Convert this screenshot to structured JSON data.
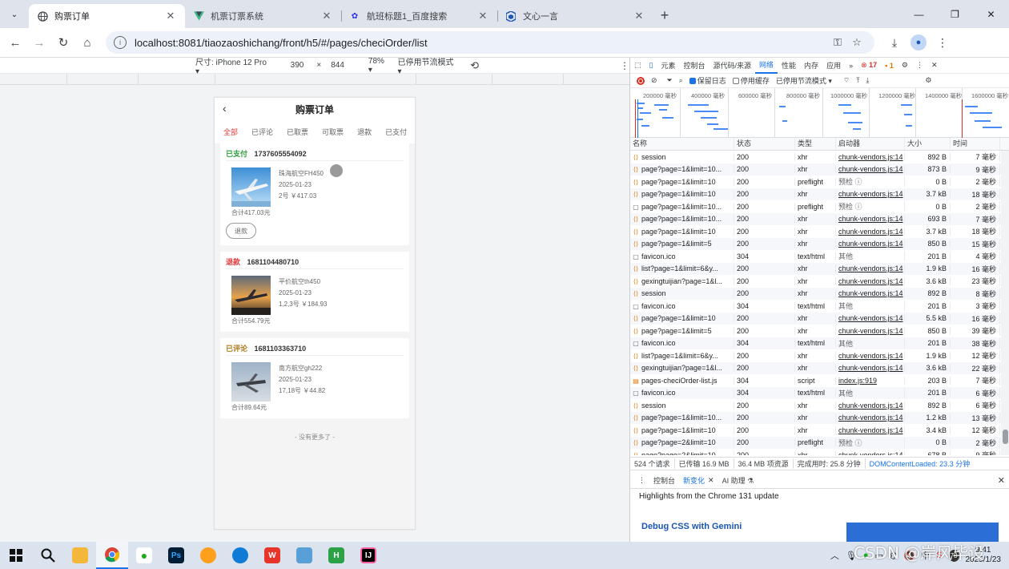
{
  "browser": {
    "tabs": [
      {
        "title": "购票订单",
        "icon": "globe-icon",
        "active": true
      },
      {
        "title": "机票订票系统",
        "icon": "vue-icon",
        "active": false
      },
      {
        "title": "航班标题1_百度搜索",
        "icon": "baidu-icon",
        "active": false
      },
      {
        "title": "文心一言",
        "icon": "cube-icon",
        "active": false
      }
    ],
    "url": "localhost:8081/tiaozaoshichang/front/h5/#/pages/checiOrder/list"
  },
  "device_toolbar": {
    "size_label": "尺寸: iPhone 12 Pro ▾",
    "width": "390",
    "times": "×",
    "height": "844",
    "zoom": "78% ▾",
    "throttle": "已停用节流模式 ▾"
  },
  "app": {
    "title": "购票订单",
    "back": "‹",
    "tabs": [
      "全部",
      "已评论",
      "已取票",
      "可取票",
      "退款",
      "已支付"
    ],
    "orders": [
      {
        "status": "已支付",
        "status_color": "#2e9e3a",
        "order_no": "1737605554092",
        "flight": "珠海航空FH450",
        "date": "2025-01-23",
        "seats": "2号 ￥417.03",
        "total": "合计417.03元",
        "action": "退款"
      },
      {
        "status": "退款",
        "status_color": "#e4393c",
        "order_no": "1681104480710",
        "flight": "平价航空th450",
        "date": "2025-01-23",
        "seats": "1,2,3号 ￥184.93",
        "total": "合计554.79元",
        "action": ""
      },
      {
        "status": "已评论",
        "status_color": "#b07a1a",
        "order_no": "1681103363710",
        "flight": "南方航空gh222",
        "date": "2025-01-23",
        "seats": "17,18号 ￥44.82",
        "total": "合计89.64元",
        "action": ""
      }
    ],
    "no_more": "- 没有更多了 -"
  },
  "devtools": {
    "tabs": [
      "元素",
      "控制台",
      "源代码/来源",
      "网络",
      "性能",
      "内存",
      "应用"
    ],
    "more": "»",
    "errors": "17",
    "warnings": "1",
    "filter": {
      "preserve_log": "保留日志",
      "disable_cache": "停用缓存",
      "throttle": "已停用节流模式"
    },
    "timeline_labels": [
      "200000 毫秒",
      "400000 毫秒",
      "600000 毫秒",
      "800000 毫秒",
      "1000000 毫秒",
      "1200000 毫秒",
      "1400000 毫秒",
      "1600000 毫秒"
    ],
    "columns": [
      "名称",
      "状态",
      "类型",
      "启动器",
      "大小",
      "时间"
    ],
    "rows": [
      {
        "name": "session",
        "status": "200",
        "type": "xhr",
        "initiator": "chunk-vendors.js:14",
        "size": "892 B",
        "time": "7 毫秒",
        "icon": "xhr"
      },
      {
        "name": "page?page=1&limit=10...",
        "status": "200",
        "type": "xhr",
        "initiator": "chunk-vendors.js:14",
        "size": "873 B",
        "time": "9 毫秒",
        "icon": "xhr"
      },
      {
        "name": "page?page=1&limit=10",
        "status": "200",
        "type": "preflight",
        "initiator": "预检 ⓘ",
        "size": "0 B",
        "time": "2 毫秒",
        "icon": "xhr"
      },
      {
        "name": "page?page=1&limit=10",
        "status": "200",
        "type": "xhr",
        "initiator": "chunk-vendors.js:14",
        "size": "3.7 kB",
        "time": "18 毫秒",
        "icon": "xhr"
      },
      {
        "name": "page?page=1&limit=10...",
        "status": "200",
        "type": "preflight",
        "initiator": "预检 ⓘ",
        "size": "0 B",
        "time": "2 毫秒",
        "icon": "doc"
      },
      {
        "name": "page?page=1&limit=10...",
        "status": "200",
        "type": "xhr",
        "initiator": "chunk-vendors.js:14",
        "size": "693 B",
        "time": "7 毫秒",
        "icon": "xhr"
      },
      {
        "name": "page?page=1&limit=10",
        "status": "200",
        "type": "xhr",
        "initiator": "chunk-vendors.js:14",
        "size": "3.7 kB",
        "time": "18 毫秒",
        "icon": "xhr"
      },
      {
        "name": "page?page=1&limit=5",
        "status": "200",
        "type": "xhr",
        "initiator": "chunk-vendors.js:14",
        "size": "850 B",
        "time": "15 毫秒",
        "icon": "xhr"
      },
      {
        "name": "favicon.ico",
        "status": "304",
        "type": "text/html",
        "initiator": "其他",
        "size": "201 B",
        "time": "4 毫秒",
        "icon": "doc"
      },
      {
        "name": "list?page=1&limit=6&y...",
        "status": "200",
        "type": "xhr",
        "initiator": "chunk-vendors.js:14",
        "size": "1.9 kB",
        "time": "16 毫秒",
        "icon": "xhr"
      },
      {
        "name": "gexingtuijian?page=1&l...",
        "status": "200",
        "type": "xhr",
        "initiator": "chunk-vendors.js:14",
        "size": "3.6 kB",
        "time": "23 毫秒",
        "icon": "xhr"
      },
      {
        "name": "session",
        "status": "200",
        "type": "xhr",
        "initiator": "chunk-vendors.js:14",
        "size": "892 B",
        "time": "8 毫秒",
        "icon": "xhr"
      },
      {
        "name": "favicon.ico",
        "status": "304",
        "type": "text/html",
        "initiator": "其他",
        "size": "201 B",
        "time": "3 毫秒",
        "icon": "doc"
      },
      {
        "name": "page?page=1&limit=10",
        "status": "200",
        "type": "xhr",
        "initiator": "chunk-vendors.js:14",
        "size": "5.5 kB",
        "time": "16 毫秒",
        "icon": "xhr"
      },
      {
        "name": "page?page=1&limit=5",
        "status": "200",
        "type": "xhr",
        "initiator": "chunk-vendors.js:14",
        "size": "850 B",
        "time": "39 毫秒",
        "icon": "xhr"
      },
      {
        "name": "favicon.ico",
        "status": "304",
        "type": "text/html",
        "initiator": "其他",
        "size": "201 B",
        "time": "38 毫秒",
        "icon": "doc"
      },
      {
        "name": "list?page=1&limit=6&y...",
        "status": "200",
        "type": "xhr",
        "initiator": "chunk-vendors.js:14",
        "size": "1.9 kB",
        "time": "12 毫秒",
        "icon": "xhr"
      },
      {
        "name": "gexingtuijian?page=1&l...",
        "status": "200",
        "type": "xhr",
        "initiator": "chunk-vendors.js:14",
        "size": "3.6 kB",
        "time": "22 毫秒",
        "icon": "xhr"
      },
      {
        "name": "pages-checiOrder-list.js",
        "status": "304",
        "type": "script",
        "initiator": "index.js:919",
        "size": "203 B",
        "time": "7 毫秒",
        "icon": "js"
      },
      {
        "name": "favicon.ico",
        "status": "304",
        "type": "text/html",
        "initiator": "其他",
        "size": "201 B",
        "time": "6 毫秒",
        "icon": "doc"
      },
      {
        "name": "session",
        "status": "200",
        "type": "xhr",
        "initiator": "chunk-vendors.js:14",
        "size": "892 B",
        "time": "6 毫秒",
        "icon": "xhr"
      },
      {
        "name": "page?page=1&limit=10...",
        "status": "200",
        "type": "xhr",
        "initiator": "chunk-vendors.js:14",
        "size": "1.2 kB",
        "time": "13 毫秒",
        "icon": "xhr"
      },
      {
        "name": "page?page=1&limit=10",
        "status": "200",
        "type": "xhr",
        "initiator": "chunk-vendors.js:14",
        "size": "3.4 kB",
        "time": "12 毫秒",
        "icon": "xhr"
      },
      {
        "name": "page?page=2&limit=10",
        "status": "200",
        "type": "preflight",
        "initiator": "预检 ⓘ",
        "size": "0 B",
        "time": "2 毫秒",
        "icon": "xhr"
      },
      {
        "name": "page?page=2&limit=10",
        "status": "200",
        "type": "xhr",
        "initiator": "chunk-vendors.js:14",
        "size": "678 B",
        "time": "9 毫秒",
        "icon": "xhr"
      }
    ],
    "summary": {
      "requests": "524 个请求",
      "transferred": "已传输 16.9 MB",
      "resources": "36.4 MB 项资源",
      "finish": "完成用时: 25.8 分钟",
      "dcl": "DOMContentLoaded: 23.3 分钟"
    },
    "drawer": {
      "tabs": [
        "控制台",
        "新变化",
        "AI 助理"
      ],
      "highlights": "Highlights from the Chrome 131 update",
      "gemini": "Debug CSS with Gemini"
    }
  },
  "taskbar": {
    "apps": [
      "windows-start-icon",
      "search-icon",
      "file-explorer-icon",
      "chrome-icon",
      "wechat-icon",
      "photoshop-icon",
      "paint-icon",
      "edge-icon",
      "wps-icon",
      "notes-icon",
      "hbuilder-icon",
      "intellij-icon"
    ],
    "tray_temp": "78",
    "ime": "中",
    "time": "9:41",
    "date": "2025/1/23"
  },
  "watermark": "CSDN @岸风毕设",
  "colors": {
    "accent": "#1a73e8",
    "brand_red": "#e4393c"
  }
}
